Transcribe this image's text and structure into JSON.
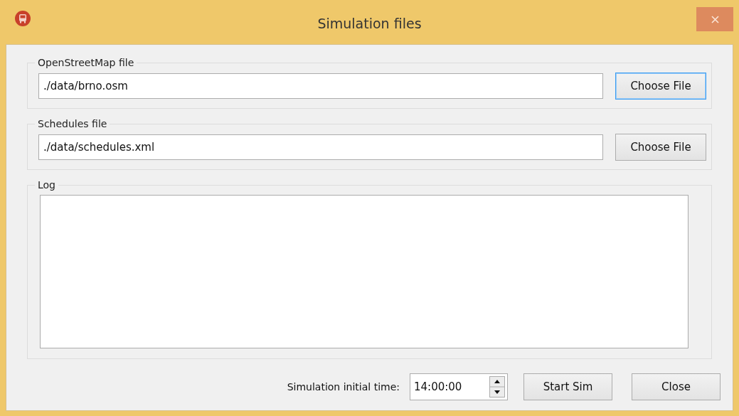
{
  "window": {
    "title": "Simulation files"
  },
  "file_groups": [
    {
      "label": "OpenStreetMap file",
      "value": "./data/brno.osm",
      "button": {
        "label": "Choose File",
        "focused": true
      }
    },
    {
      "label": "Schedules file",
      "value": "./data/schedules.xml",
      "button": {
        "label": "Choose File",
        "focused": false
      }
    }
  ],
  "log": {
    "label": "Log"
  },
  "footer": {
    "time_label": "Simulation initial time:",
    "time_value": "14:00:00",
    "buttons": [
      {
        "label": "Start Sim",
        "focused": false
      },
      {
        "label": "Close",
        "focused": false
      }
    ]
  }
}
